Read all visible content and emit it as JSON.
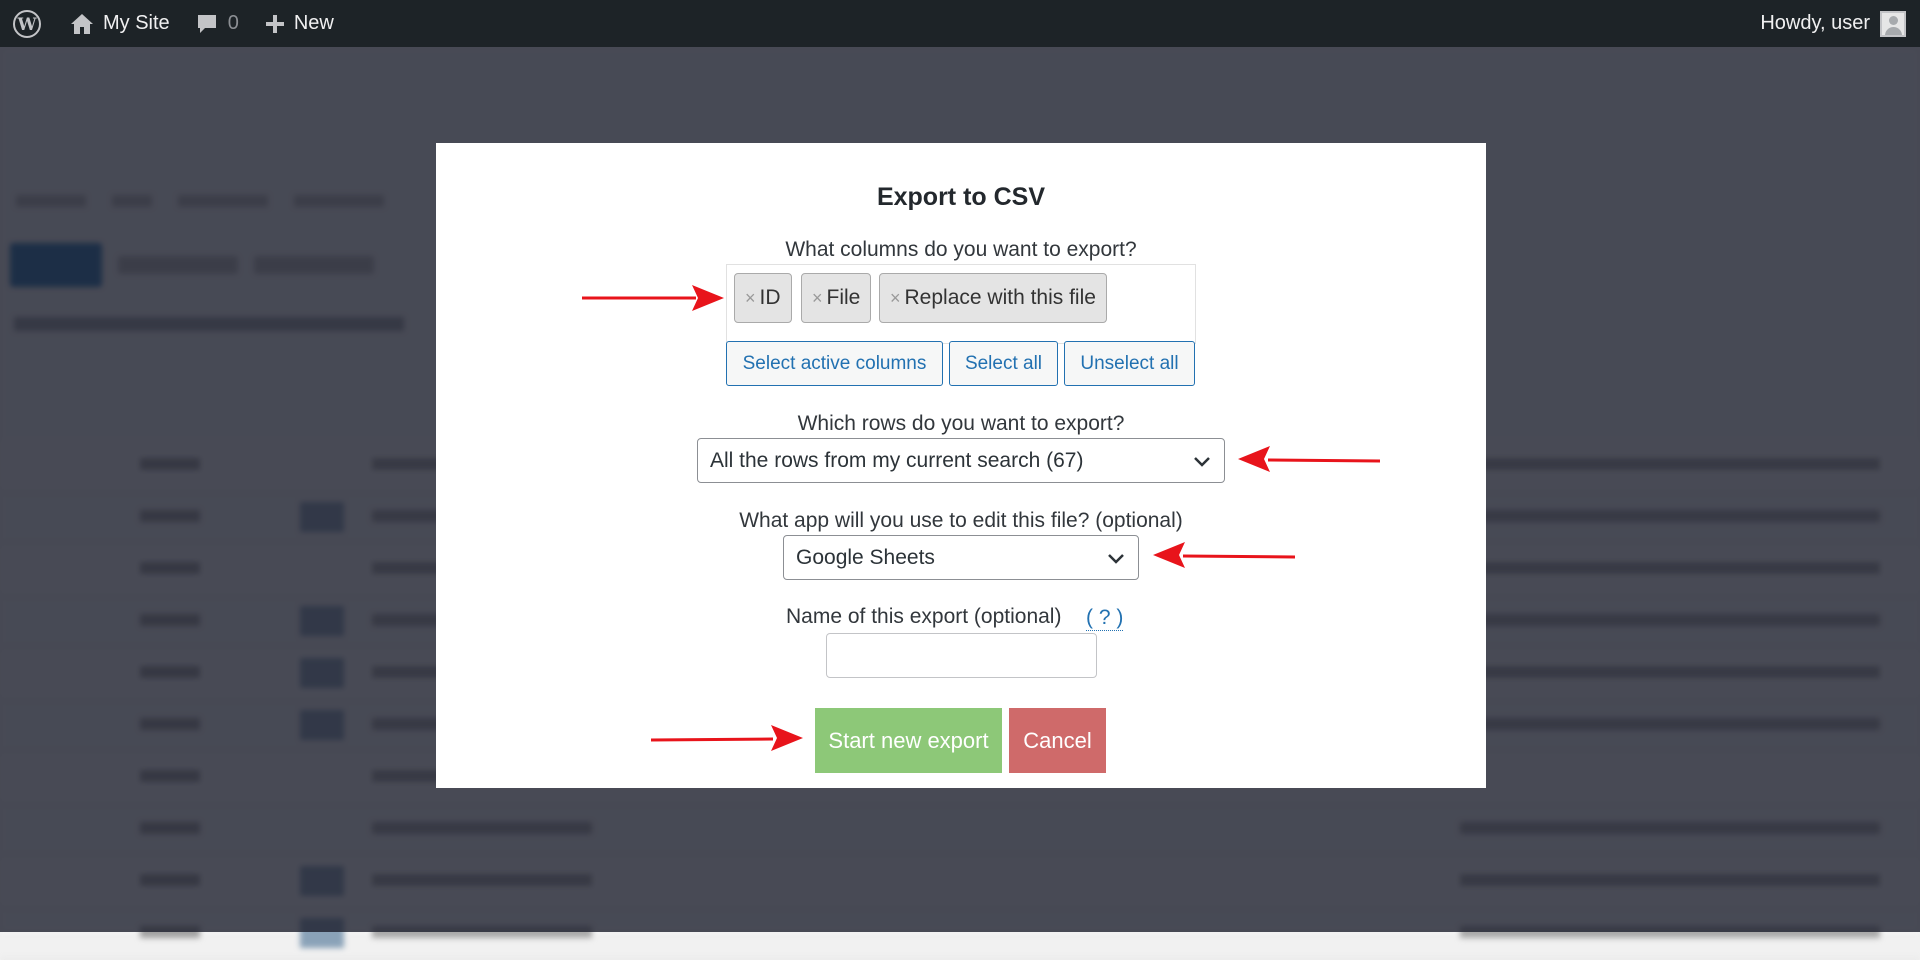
{
  "adminbar": {
    "site_name": "My Site",
    "comments_count": "0",
    "new_label": "New",
    "howdy": "Howdy, user"
  },
  "modal": {
    "title": "Export to CSV",
    "columns_question": "What columns do you want to export?",
    "selected_columns": [
      "ID",
      "File",
      "Replace with this file"
    ],
    "remove_symbol": "×",
    "select_active_label": "Select active columns",
    "select_all_label": "Select all",
    "unselect_all_label": "Unselect all",
    "rows_question": "Which rows do you want to export?",
    "rows_value": "All the rows from my current search (67)",
    "app_question": "What app will you use to edit this file? (optional)",
    "app_value": "Google Sheets",
    "name_label": "Name of this export (optional)",
    "help_link": "( ? )",
    "name_value": "",
    "start_label": "Start new export",
    "cancel_label": "Cancel"
  },
  "colors": {
    "adminbar_bg": "#1d2327",
    "accent": "#2271b1",
    "start_button": "#8dc878",
    "cancel_button": "#cf6a6a",
    "annotation_arrow": "#e8141b"
  },
  "icons": [
    "wordpress-icon",
    "home-icon",
    "comment-icon",
    "plus-icon",
    "chevron-down-icon",
    "avatar"
  ]
}
